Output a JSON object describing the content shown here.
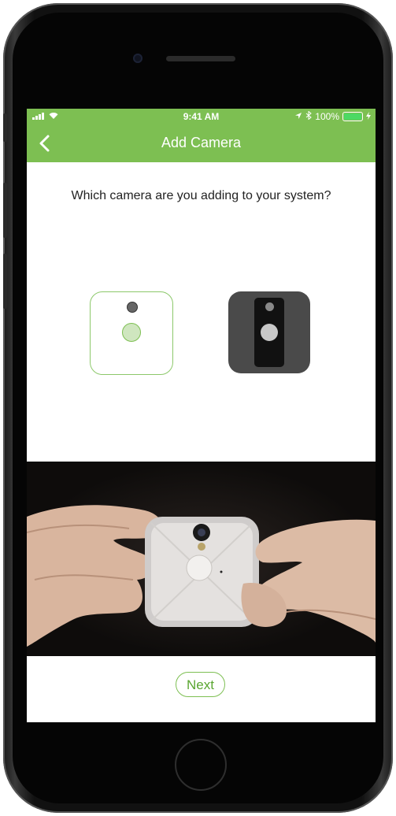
{
  "status_bar": {
    "time": "9:41 AM",
    "battery": "100%",
    "signal_icon": "signal-bars-icon",
    "wifi_icon": "wifi-icon",
    "location_icon": "location-arrow-icon",
    "bluetooth_icon": "bluetooth-icon",
    "charging_icon": "charging-bolt-icon"
  },
  "nav": {
    "title": "Add Camera",
    "back_icon": "chevron-left-icon"
  },
  "main": {
    "question": "Which camera are you adding to your system?",
    "options": [
      {
        "name": "white-camera",
        "selected": true
      },
      {
        "name": "black-camera",
        "selected": false
      }
    ],
    "next_label": "Next"
  },
  "colors": {
    "brand_green": "#7dbf52",
    "text": "#222222",
    "dark_camera": "#4a4a4a"
  }
}
